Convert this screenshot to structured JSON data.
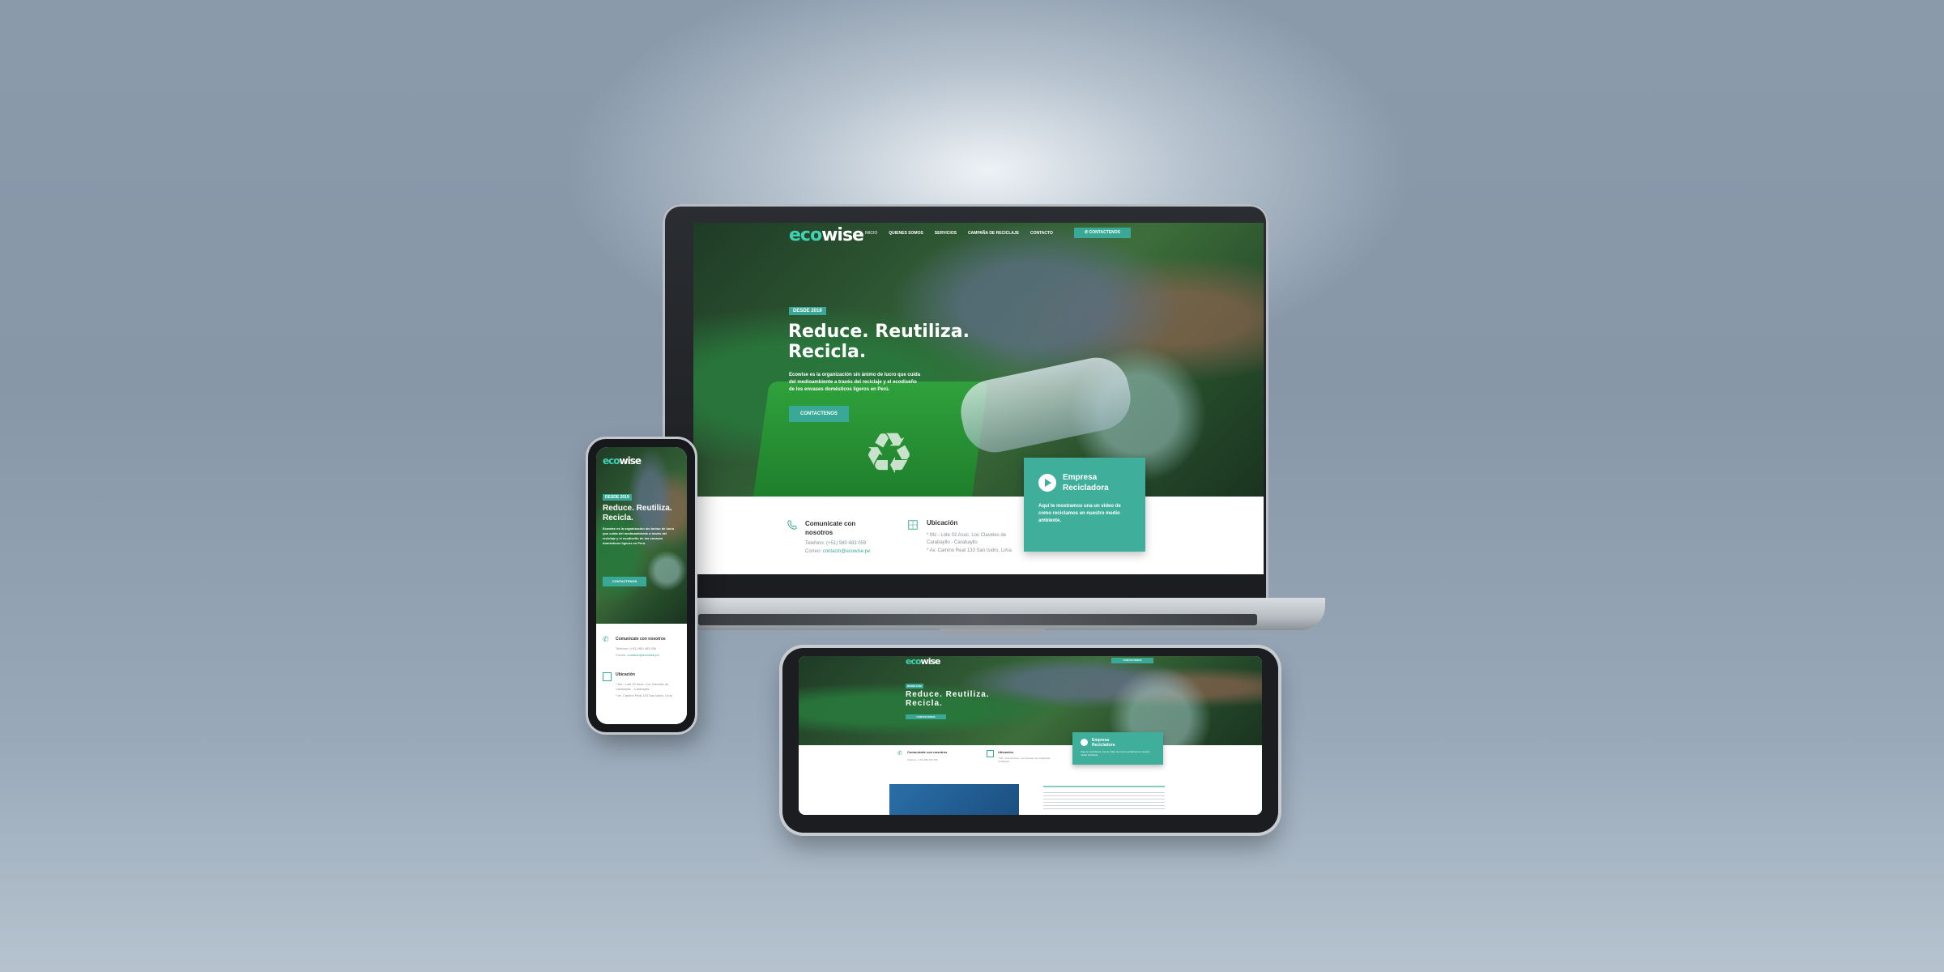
{
  "brand": {
    "logo_eco": "eco",
    "logo_wise": "wise",
    "accent": "#3aa896",
    "accent_light": "#3fd1b0",
    "dark": "#1f3b26"
  },
  "nav": {
    "items": [
      "INICIO",
      "QUIENES SOMOS",
      "SERVICIOS",
      "CAMPAÑA DE RECICLAJE",
      "CONTACTO"
    ],
    "cta": "CONTACTENOS"
  },
  "hero": {
    "tag": "DESDE 2019",
    "title_line1": "Reduce. Reutiliza.",
    "title_line2": "Recicla.",
    "body": "Ecowise es la organización sin ánimo de lucro que cuida del medioambiente a través del reciclaje y el ecodiseño de los envases domésticos ligeros en Perú.",
    "button": "CONTACTENOS"
  },
  "contact": {
    "title": "Comunicate con nosotros",
    "phone": "Telefono: (+51) 980 483 059",
    "email_label": "Correo:",
    "email": "contacto@ecowise.pe"
  },
  "location": {
    "title": "Ubicación",
    "line1": "* Mz.- Lote 02 Asoc. Los Claveles de Carabayllo - Carabayllo",
    "line2": "* Av. Camino Real 133 San Isidro, Lima"
  },
  "video_card": {
    "title_line1": "Empresa",
    "title_line2": "Recicladora",
    "body": "Aquí te mostramos una un video de como reciclamos en nuestro medio ambiente."
  }
}
